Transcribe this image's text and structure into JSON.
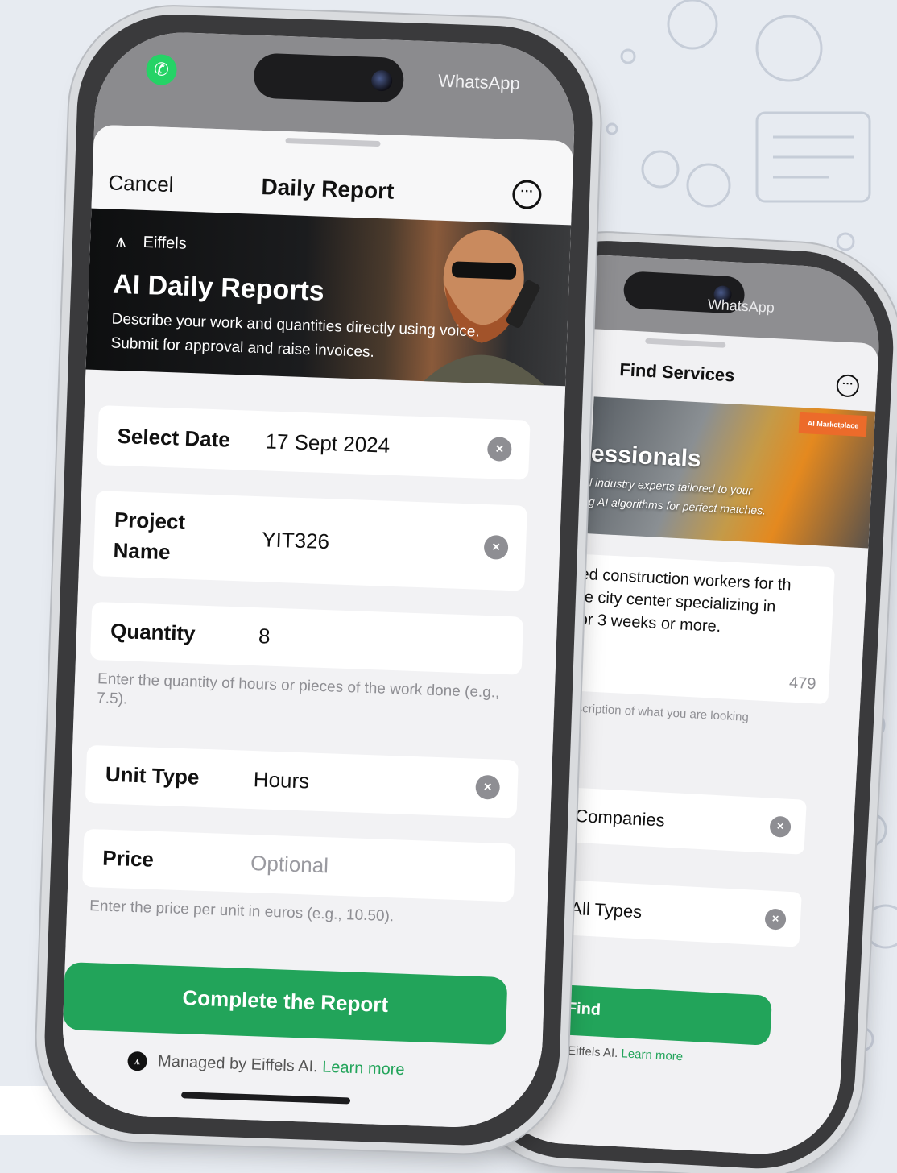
{
  "front": {
    "whatsapp_label": "WhatsApp",
    "header": {
      "cancel": "Cancel",
      "title": "Daily Report",
      "more": "···"
    },
    "hero": {
      "brand": "Eiffels",
      "title": "AI Daily Reports",
      "description": "Describe your work and quantities directly using voice. Submit for approval and raise invoices."
    },
    "fields": {
      "date": {
        "label": "Select Date",
        "value": "17 Sept 2024"
      },
      "project": {
        "label": "Project Name",
        "value": "YIT326"
      },
      "quantity": {
        "label": "Quantity",
        "value": "8",
        "hint": "Enter the quantity of hours or pieces of the work done (e.g., 7.5)."
      },
      "unit": {
        "label": "Unit Type",
        "value": "Hours"
      },
      "price": {
        "label": "Price",
        "placeholder": "Optional",
        "hint": "Enter the price per unit in euros (e.g., 10.50)."
      }
    },
    "cta": "Complete the Report",
    "footer": {
      "managed": "Managed by Eiffels AI.",
      "learn_more": "Learn more"
    }
  },
  "back": {
    "whatsapp_label": "WhatsApp",
    "header": {
      "title": "Find Services",
      "more": "···"
    },
    "banner": {
      "badge": "AI Marketplace",
      "title": "essionals",
      "line1": "l industry experts tailored to your",
      "line2": "g AI algorithms for perfect matches."
    },
    "request": {
      "line1": "ied construction workers for th",
      "line2": "he city center specializing in",
      "line3": "for 3 weeks or more.",
      "count": "479",
      "hint": "escription of what you are looking"
    },
    "filters": {
      "companies": "Companies",
      "types": "All Types"
    },
    "find": "Find",
    "footer": {
      "managed": "by Eiffels AI.",
      "learn_more": "Learn more"
    }
  },
  "colors": {
    "accent": "#22a45a",
    "whatsapp": "#25d366",
    "badge": "#ec6b2a"
  },
  "icons": [
    "whatsapp-icon",
    "eiffels-logo-icon",
    "more-icon",
    "clear-icon"
  ]
}
